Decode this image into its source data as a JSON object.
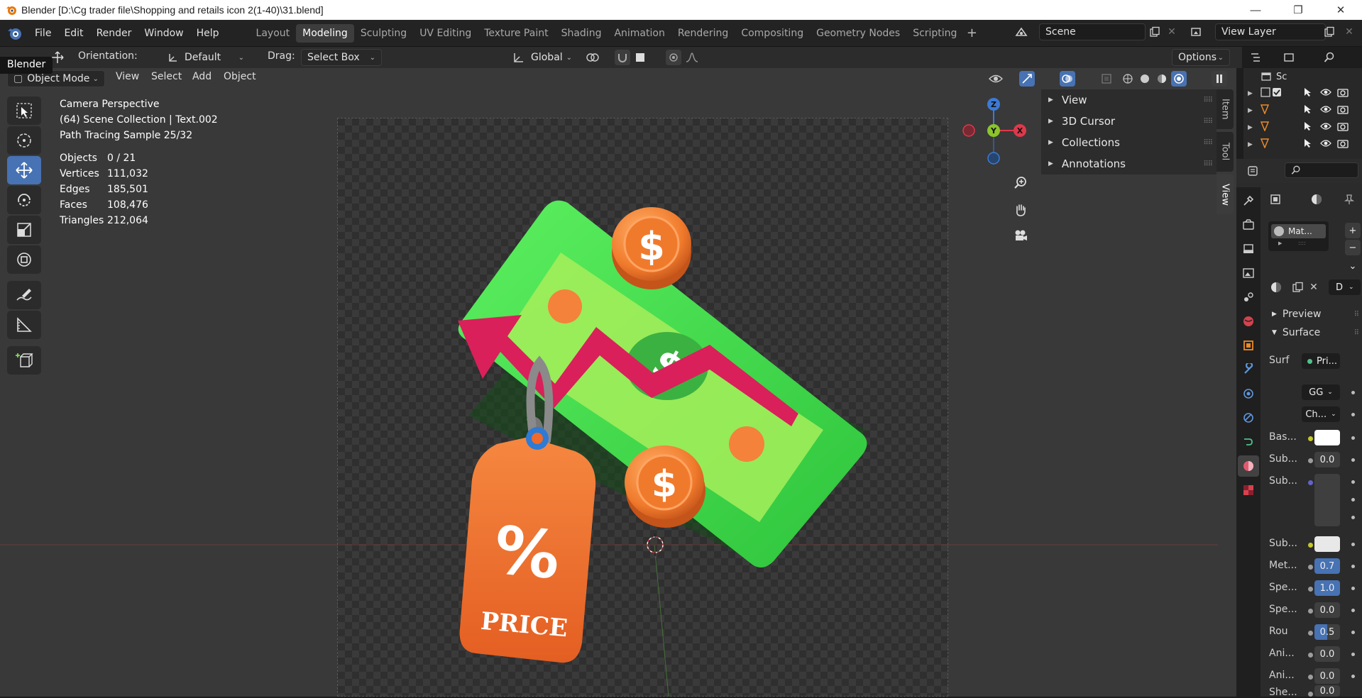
{
  "window": {
    "title": "Blender [D:\\Cg trader file\\Shopping and retails icon 2(1-40)\\31.blend]",
    "controls": [
      "—",
      "❐",
      "✕"
    ]
  },
  "menu": [
    "File",
    "Edit",
    "Render",
    "Window",
    "Help"
  ],
  "workspaces": [
    "Layout",
    "Modeling",
    "Sculpting",
    "UV Editing",
    "Texture Paint",
    "Shading",
    "Animation",
    "Rendering",
    "Compositing",
    "Geometry Nodes",
    "Scripting"
  ],
  "active_workspace": "Modeling",
  "scene": {
    "name": "Scene",
    "view_layer": "View Layer"
  },
  "tool_header": {
    "orientation_label": "Orientation:",
    "orientation_value": "Default",
    "drag_label": "Drag:",
    "drag_value": "Select Box",
    "transform_orientation": "Global",
    "options": "Options"
  },
  "viewport_header": {
    "mode": "Object Mode",
    "menus": [
      "View",
      "Select",
      "Add",
      "Object"
    ]
  },
  "tooltip": "Blender",
  "viewport_info": {
    "perspective": "Camera Perspective",
    "collection": "(64) Scene Collection | Text.002",
    "render_status": "Path Tracing Sample 25/32"
  },
  "stats": [
    {
      "label": "Objects",
      "value": "0 / 21"
    },
    {
      "label": "Vertices",
      "value": "111,032"
    },
    {
      "label": "Edges",
      "value": "185,501"
    },
    {
      "label": "Faces",
      "value": "108,476"
    },
    {
      "label": "Triangles",
      "value": "212,064"
    }
  ],
  "sidebar": {
    "panels": [
      "View",
      "3D Cursor",
      "Collections",
      "Annotations"
    ],
    "tabs": [
      "Item",
      "Tool",
      "View"
    ],
    "active_tab": "View"
  },
  "gizmo": {
    "z": "Z",
    "y": "Y",
    "x": "X"
  },
  "scene_content": {
    "tag_text": "PRICE",
    "percent": "%",
    "coin_symbol": "$"
  },
  "outliner": {
    "root": "Sc"
  },
  "properties": {
    "material_slot": "Mat...",
    "mat_dropdown": "D",
    "sections": {
      "preview": "Preview",
      "surface": "Surface"
    },
    "surface_label": "Surf",
    "surface_value": "Pri...",
    "gg": "GG",
    "ch": "Ch...",
    "fields": [
      {
        "label": "Bas...",
        "value": ""
      },
      {
        "label": "Sub...",
        "value": "0.0"
      },
      {
        "label": "Sub...",
        "value": ""
      },
      {
        "label": "Sub...",
        "value": ""
      },
      {
        "label": "Met...",
        "value": "0.7"
      },
      {
        "label": "Spe...",
        "value": "1.0"
      },
      {
        "label": "Spe...",
        "value": "0.0"
      },
      {
        "label": "Rou",
        "value": "0.5"
      },
      {
        "label": "Ani...",
        "value": "0.0"
      },
      {
        "label": "Ani...",
        "value": "0.0"
      },
      {
        "label": "She...",
        "value": "0.0"
      }
    ]
  },
  "colors": {
    "accent": "#4772b3",
    "x_axis": "#e0384b",
    "y_axis": "#8bc52b",
    "z_axis": "#3c7ad6",
    "money_green": "#3fd84a",
    "arrow_pink": "#d9205a",
    "tag_orange": "#ee6b2a"
  }
}
